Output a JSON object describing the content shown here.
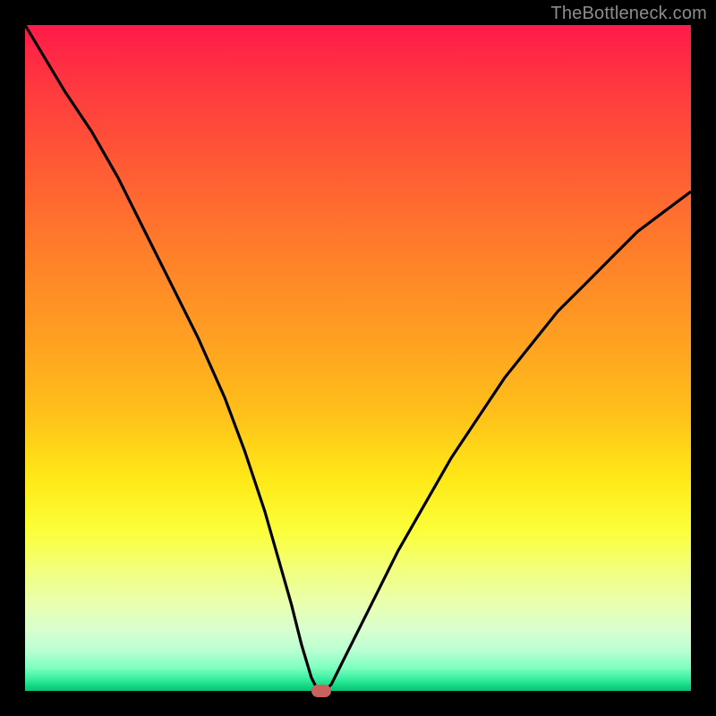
{
  "watermark": "TheBottleneck.com",
  "chart_data": {
    "type": "line",
    "title": "",
    "xlabel": "",
    "ylabel": "",
    "xlim": [
      0,
      100
    ],
    "ylim": [
      0,
      100
    ],
    "grid": false,
    "legend": false,
    "background_gradient": {
      "orientation": "vertical",
      "stops": [
        {
          "pos": 0.0,
          "color": "#ff1a4a"
        },
        {
          "pos": 0.5,
          "color": "#ffb81e"
        },
        {
          "pos": 0.78,
          "color": "#f8ff55"
        },
        {
          "pos": 0.92,
          "color": "#d0ffcf"
        },
        {
          "pos": 1.0,
          "color": "#0ac072"
        }
      ]
    },
    "series": [
      {
        "name": "bottleneck-curve",
        "x": [
          0,
          3,
          6,
          10,
          14,
          18,
          22,
          26,
          30,
          33,
          36,
          38,
          40,
          41.5,
          43,
          44,
          45,
          46,
          48,
          52,
          56,
          60,
          64,
          68,
          72,
          76,
          80,
          84,
          88,
          92,
          96,
          100
        ],
        "y": [
          100,
          95,
          90,
          84,
          77,
          69,
          61,
          53,
          44,
          36,
          27,
          20,
          13,
          7,
          2,
          0,
          0,
          1,
          5,
          13,
          21,
          28,
          35,
          41,
          47,
          52,
          57,
          61,
          65,
          69,
          72,
          75
        ]
      }
    ],
    "marker": {
      "x": 44.5,
      "y": 0,
      "color": "#c9615d"
    }
  }
}
